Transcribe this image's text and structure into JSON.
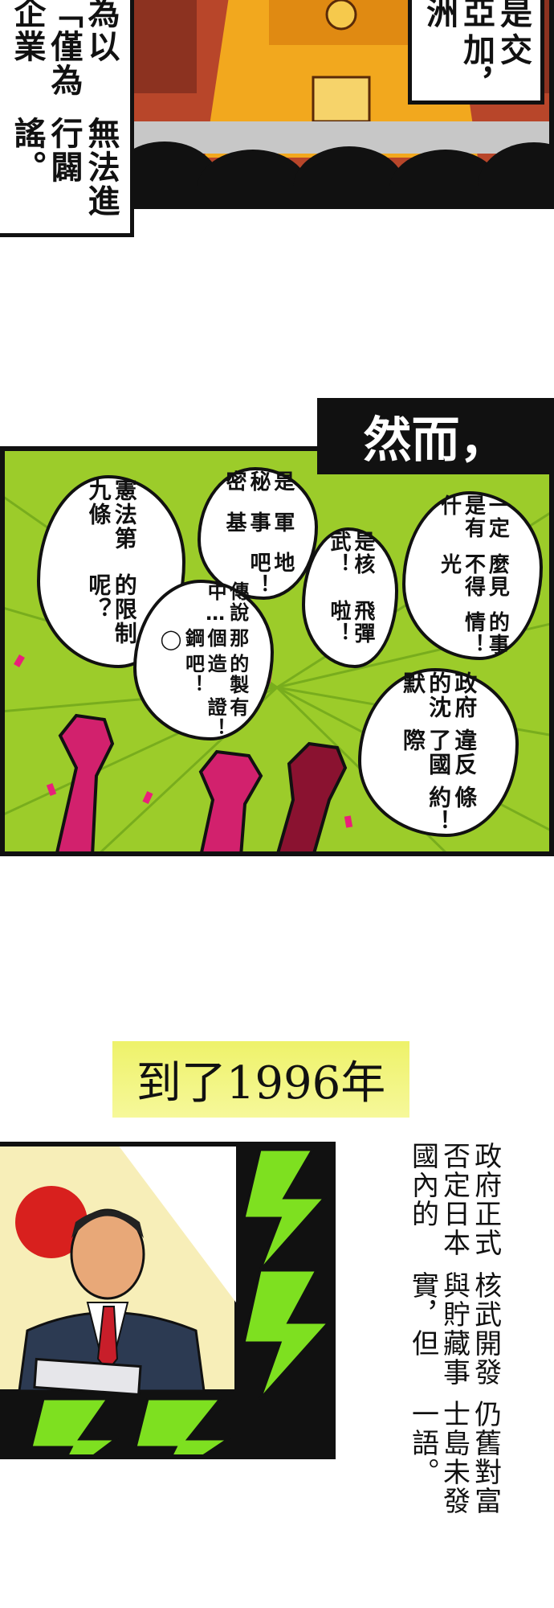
{
  "panel1": {
    "left_caption_lines": [
      "為以「僅為企業",
      "無法進行闢謠。"
    ],
    "right_caption_lines": [
      "是亞洲",
      "交加，"
    ]
  },
  "panel2": {
    "banner": "然而，",
    "bubbles": {
      "constitution": [
        "憲法第九條",
        "的限制呢？"
      ],
      "secret_base": [
        "是秘密",
        "軍事基",
        "地吧！"
      ],
      "nuclear": [
        "是核武！",
        "飛彈啦！"
      ],
      "cant_see_light": [
        "一定是有什",
        "麼見不得光",
        "的事情！"
      ],
      "legend": [
        "傳說中…",
        "那個鋼◯",
        "的製造吧！",
        "有證！"
      ],
      "treaty": [
        "政府的沈默",
        "違反了國際",
        "條約！"
      ]
    }
  },
  "year_caption": "到了1996年",
  "panel3": {
    "caption_lines": [
      "政府正式否定日本國內的",
      "核武開發與貯藏事實，但",
      "仍舊對富士島未發一語。"
    ]
  },
  "colors": {
    "green_bg": "#9ccc2a",
    "yellow_bg": "#eef26a",
    "fist_pink": "#d2216d",
    "fist_dark": "#8a1230",
    "bolt_green": "#7ee020",
    "panel_border": "#111111"
  }
}
